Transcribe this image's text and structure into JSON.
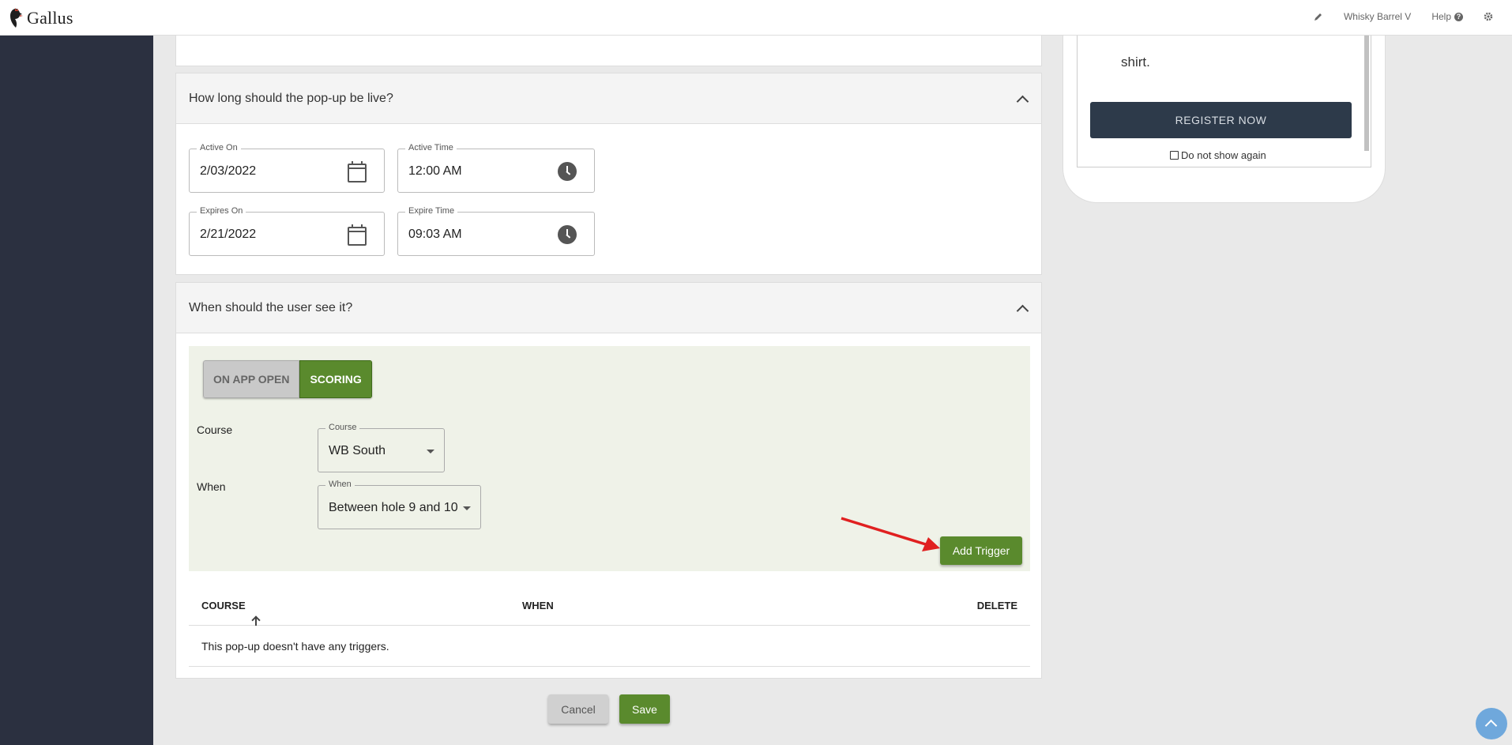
{
  "brand": {
    "name": "Gallus"
  },
  "topnav": {
    "user": "Whisky Barrel V",
    "help": "Help",
    "edit_icon": "pencil-icon",
    "settings_icon": "gear-icon"
  },
  "live_section": {
    "title": "How long should the pop-up be live?",
    "active_on": {
      "label": "Active On",
      "value": "2/03/2022"
    },
    "active_time": {
      "label": "Active Time",
      "value": "12:00 AM"
    },
    "expires_on": {
      "label": "Expires On",
      "value": "2/21/2022"
    },
    "expire_time": {
      "label": "Expire Time",
      "value": "09:03 AM"
    }
  },
  "when_section": {
    "title": "When should the user see it?",
    "toggle": {
      "options": [
        "ON APP OPEN",
        "SCORING"
      ],
      "selected": "SCORING"
    },
    "course": {
      "row_label": "Course",
      "field_label": "Course",
      "value": "WB South"
    },
    "when": {
      "row_label": "When",
      "field_label": "When",
      "value": "Between hole 9 and 10"
    },
    "add_trigger": "Add Trigger"
  },
  "table": {
    "columns": [
      "COURSE",
      "WHEN",
      "DELETE"
    ],
    "empty_message": "This pop-up doesn't have any triggers."
  },
  "actions": {
    "cancel": "Cancel",
    "save": "Save"
  },
  "preview": {
    "text": "shirt.",
    "register": "REGISTER NOW",
    "dont_show": "Do not show again"
  },
  "colors": {
    "sidebar": "#2b3040",
    "accent_green": "#5a8a2d",
    "trigger_panel": "#eff2e8",
    "register_button": "#2d3a4a",
    "arrow": "#e02020"
  }
}
